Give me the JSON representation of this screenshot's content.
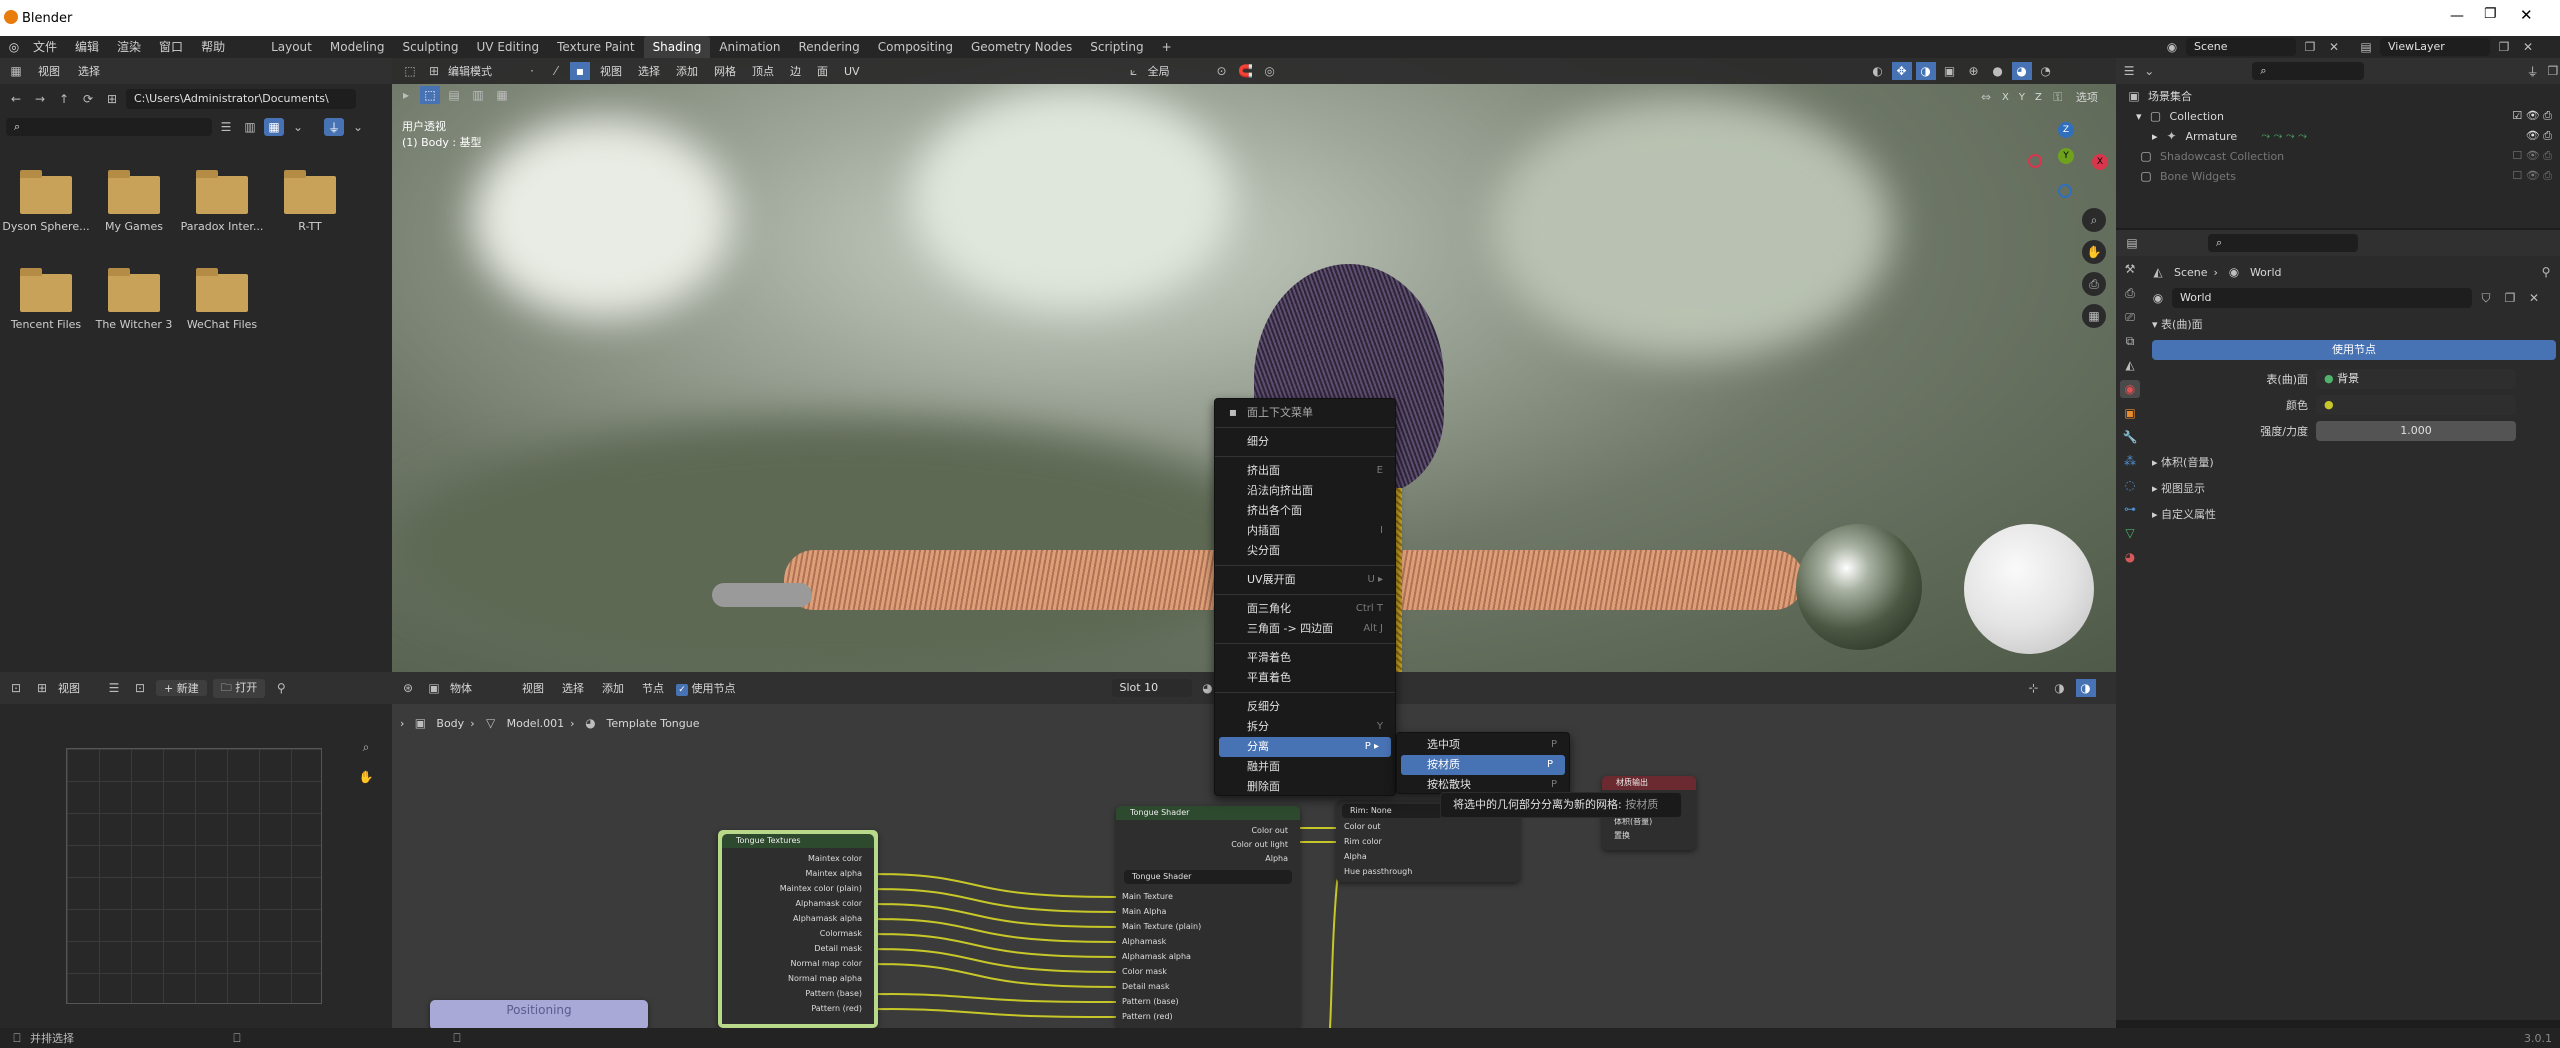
{
  "window": {
    "title": "Blender"
  },
  "menubar": {
    "items": [
      "文件",
      "编辑",
      "渲染",
      "窗口",
      "帮助"
    ]
  },
  "workspaces": [
    "Layout",
    "Modeling",
    "Sculpting",
    "UV Editing",
    "Texture Paint",
    "Shading",
    "Animation",
    "Rendering",
    "Compositing",
    "Geometry Nodes",
    "Scripting"
  ],
  "active_workspace": "Shading",
  "topright": {
    "scene": "Scene",
    "viewlayer": "ViewLayer"
  },
  "filebrowser": {
    "menu": [
      "视图",
      "选择"
    ],
    "path": "C:\\Users\\Administrator\\Documents\\",
    "folders": [
      "Dyson Sphere...",
      "My Games",
      "Paradox Inter...",
      "R-TT",
      "Tencent Files",
      "The Witcher 3",
      "WeChat Files"
    ]
  },
  "viewport": {
    "mode": "编辑模式",
    "menu": [
      "视图",
      "选择",
      "添加",
      "网格",
      "顶点",
      "边",
      "面",
      "UV"
    ],
    "transform": "全局",
    "options": "选项",
    "axes": [
      "X",
      "Y",
      "Z"
    ],
    "overlay_title": "用户透视",
    "overlay_sub": "(1) Body : 基型"
  },
  "context_menu": {
    "title": "面上下文菜单",
    "groups": [
      [
        {
          "label": "细分",
          "sc": ""
        }
      ],
      [
        {
          "label": "挤出面",
          "sc": "E"
        },
        {
          "label": "沿法向挤出面",
          "sc": ""
        },
        {
          "label": "挤出各个面",
          "sc": ""
        },
        {
          "label": "内插面",
          "sc": "I"
        },
        {
          "label": "尖分面",
          "sc": ""
        }
      ],
      [
        {
          "label": "UV展开面",
          "sc": "U ▸"
        }
      ],
      [
        {
          "label": "面三角化",
          "sc": "Ctrl T"
        },
        {
          "label": "三角面 -> 四边面",
          "sc": "Alt J"
        }
      ],
      [
        {
          "label": "平滑着色",
          "sc": ""
        },
        {
          "label": "平直着色",
          "sc": ""
        }
      ],
      [
        {
          "label": "反细分",
          "sc": ""
        },
        {
          "label": "拆分",
          "sc": "Y"
        },
        {
          "label": "分离",
          "sc": "P ▸"
        },
        {
          "label": "融并面",
          "sc": ""
        },
        {
          "label": "删除面",
          "sc": ""
        }
      ]
    ],
    "highlight": "分离"
  },
  "submenu": {
    "items": [
      {
        "label": "选中项",
        "sc": "P"
      },
      {
        "label": "按材质",
        "sc": "P"
      },
      {
        "label": "按松散块",
        "sc": "P"
      }
    ],
    "highlight": "按材质"
  },
  "tooltip": {
    "text": "将选中的几何部分分离为新的网格:",
    "hint": "按材质"
  },
  "outliner": {
    "root": "场景集合",
    "items": [
      "Collection",
      "Armature",
      "Shadowcast Collection",
      "Bone Widgets"
    ]
  },
  "properties": {
    "breadcrumb": [
      "Scene",
      "World"
    ],
    "world_name": "World",
    "surface_title": "表(曲)面",
    "use_nodes": "使用节点",
    "surface_label": "表(曲)面",
    "surface_value": "背景",
    "color_label": "颜色",
    "strength_label": "强度/力度",
    "strength_value": "1.000",
    "sections": [
      "体积(音量)",
      "视图显示",
      "自定义属性"
    ]
  },
  "image_editor": {
    "view": "视图",
    "new": "新建",
    "open": "打开"
  },
  "node_editor": {
    "object": "物体",
    "menu": [
      "视图",
      "选择",
      "添加",
      "节点"
    ],
    "use_nodes": "使用节点",
    "slot": "Slot 10",
    "breadcrumb": [
      "Body",
      "Model.001",
      "Template Tongue"
    ],
    "nodes": {
      "tex_title": "Tongue Textures",
      "tex_outputs": [
        "Maintex color",
        "Maintex alpha",
        "Maintex color (plain)",
        "Alphamask color",
        "Alphamask alpha",
        "Colormask",
        "Detail mask",
        "Normal map color",
        "Normal map alpha",
        "Pattern (base)",
        "Pattern (red)"
      ],
      "shader_title": "Tongue Shader",
      "shader_outputs": [
        "Color out",
        "Color out light",
        "Alpha"
      ],
      "shader_group": "Tongue Shader",
      "shader_inputs": [
        "Main Texture",
        "Main Alpha",
        "Main Texture (plain)",
        "Alphamask",
        "Alphamask alpha",
        "Color mask",
        "Detail mask",
        "Pattern (base)",
        "Pattern (red)"
      ],
      "rim_value": "Rim: None",
      "rim_outputs": [
        "Color out",
        "Rim color",
        "Alpha",
        "Hue passthrough"
      ],
      "mat_title": "材质输出",
      "mat_inputs": [
        "体积(音量)",
        "置换"
      ],
      "pos_title": "Positioning"
    }
  },
  "status": {
    "left": "并排选择",
    "version": "3.0.1"
  }
}
